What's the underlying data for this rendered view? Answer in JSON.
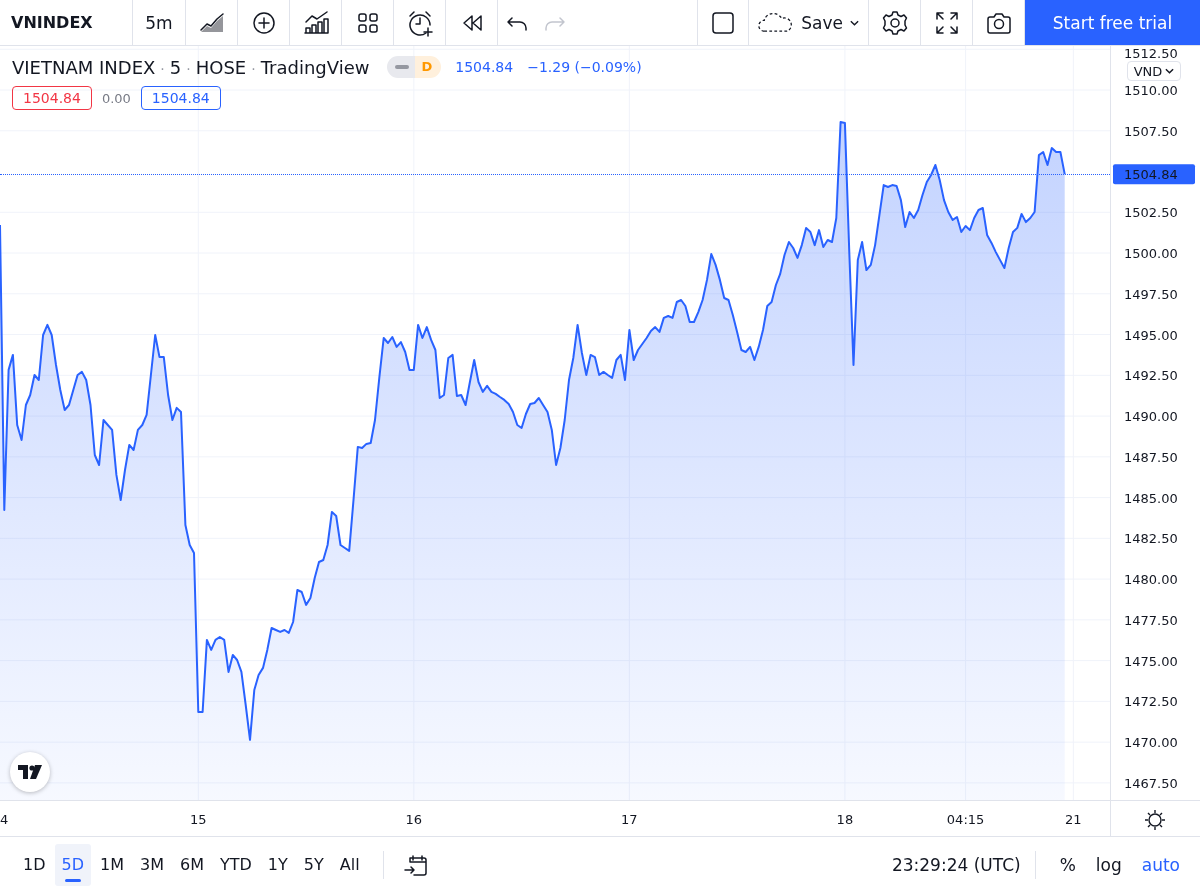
{
  "toolbar": {
    "symbol": "VNINDEX",
    "interval": "5m",
    "tools": [
      {
        "kind": "area-style",
        "disabled": false
      },
      {
        "kind": "add",
        "disabled": false
      },
      {
        "kind": "indicators",
        "disabled": false
      },
      {
        "kind": "layout",
        "disabled": false
      },
      {
        "kind": "alert",
        "disabled": false
      },
      {
        "kind": "replay",
        "disabled": false
      },
      {
        "kind": "undo",
        "disabled": false
      },
      {
        "kind": "redo",
        "disabled": true
      }
    ],
    "right_tools": [
      {
        "kind": "rectangle"
      }
    ],
    "save": {
      "label": "Save"
    },
    "extra_tools": [
      {
        "kind": "settings"
      },
      {
        "kind": "fullscreen"
      },
      {
        "kind": "snapshot"
      }
    ],
    "trial_button": "Start free trial"
  },
  "legend": {
    "title_parts": [
      "VIETNAM INDEX",
      "5",
      "HOSE",
      "TradingView"
    ],
    "separator": "·",
    "badge": "D",
    "price": "1504.84",
    "change": "−1.29 (−0.09%)",
    "values": [
      {
        "kind": "boxed",
        "text": "1504.84",
        "color": "#f23645"
      },
      {
        "kind": "plain",
        "text": "0.00",
        "color": "#787b86"
      },
      {
        "kind": "boxed",
        "text": "1504.84",
        "color": "#2962ff"
      }
    ]
  },
  "currency": "VND",
  "chart": {
    "last_price_label": "1504.84",
    "time_axis": [
      "4",
      "15",
      "16",
      "17",
      "18",
      "04:15",
      "21"
    ],
    "chart_data": {
      "type": "area",
      "ylim": [
        1466.45,
        1512.7
      ],
      "grid": true,
      "yticks": [
        {
          "value": 1467.5,
          "label": "1467.50"
        },
        {
          "value": 1470,
          "label": "1470.00"
        },
        {
          "value": 1472.5,
          "label": "1472.50"
        },
        {
          "value": 1475,
          "label": "1475.00"
        },
        {
          "value": 1477.5,
          "label": "1477.50"
        },
        {
          "value": 1480,
          "label": "1480.00"
        },
        {
          "value": 1482.5,
          "label": "1482.50"
        },
        {
          "value": 1485,
          "label": "1485.00"
        },
        {
          "value": 1487.5,
          "label": "1487.50"
        },
        {
          "value": 1490,
          "label": "1490.00"
        },
        {
          "value": 1492.5,
          "label": "1492.50"
        },
        {
          "value": 1495,
          "label": "1495.00"
        },
        {
          "value": 1497.5,
          "label": "1497.50"
        },
        {
          "value": 1500,
          "label": "1500.00"
        },
        {
          "value": 1502.5,
          "label": "1502.50"
        },
        {
          "value": 1507.5,
          "label": "1507.50"
        },
        {
          "value": 1510,
          "label": "1510.00"
        },
        {
          "value": 1512.5,
          "label": "1512.50"
        }
      ],
      "series": [
        {
          "color": "#2962ff",
          "values": [
            1501.72,
            1484.24,
            1492.83,
            1493.75,
            1489.45,
            1488.53,
            1490.68,
            1491.29,
            1492.52,
            1492.21,
            1494.97,
            1495.59,
            1494.97,
            1493.13,
            1491.6,
            1490.37,
            1490.68,
            1491.6,
            1492.52,
            1492.71,
            1492.21,
            1490.68,
            1487.61,
            1487.0,
            1489.76,
            1489.45,
            1489.15,
            1486.39,
            1484.85,
            1486.69,
            1488.23,
            1487.92,
            1489.15,
            1489.45,
            1490.07,
            1492.52,
            1494.97,
            1493.62,
            1493.62,
            1491.29,
            1489.76,
            1490.5,
            1490.25,
            1483.32,
            1482.09,
            1481.6,
            1471.85,
            1471.85,
            1476.27,
            1475.66,
            1476.27,
            1476.45,
            1476.27,
            1474.31,
            1475.35,
            1475.04,
            1474.31,
            1472.28,
            1470.14,
            1473.2,
            1474.12,
            1474.55,
            1475.66,
            1477.0,
            1476.88,
            1476.76,
            1476.88,
            1476.7,
            1477.37,
            1479.33,
            1479.21,
            1478.42,
            1478.84,
            1480.07,
            1481.05,
            1481.17,
            1482.09,
            1484.12,
            1483.87,
            1482.09,
            1481.91,
            1481.73,
            1484.85,
            1488.11,
            1488.04,
            1488.29,
            1488.35,
            1489.76,
            1492.34,
            1494.79,
            1494.48,
            1494.85,
            1494.24,
            1494.54,
            1493.93,
            1492.83,
            1492.83,
            1495.59,
            1494.79,
            1495.46,
            1494.67,
            1494.05,
            1491.11,
            1491.29,
            1493.56,
            1493.75,
            1491.23,
            1491.29,
            1490.68,
            1492.09,
            1493.44,
            1492.09,
            1491.48,
            1491.85,
            1491.48,
            1491.36,
            1491.17,
            1490.99,
            1490.74,
            1490.25,
            1489.45,
            1489.27,
            1490.13,
            1490.74,
            1490.8,
            1491.11,
            1490.68,
            1490.25,
            1489.15,
            1487.0,
            1488.04,
            1489.76,
            1492.21,
            1493.56,
            1495.59,
            1493.87,
            1492.52,
            1493.75,
            1493.62,
            1492.52,
            1492.71,
            1492.52,
            1492.34,
            1493.44,
            1493.75,
            1492.21,
            1495.28,
            1493.44,
            1494.05,
            1494.42,
            1494.79,
            1495.22,
            1495.46,
            1495.16,
            1496.02,
            1496.14,
            1496.02,
            1497.0,
            1497.12,
            1496.75,
            1495.77,
            1495.77,
            1496.38,
            1497.12,
            1498.35,
            1499.94,
            1499.27,
            1498.35,
            1497.24,
            1497.12,
            1496.2,
            1495.16,
            1494.05,
            1493.93,
            1494.24,
            1493.44,
            1494.24,
            1495.28,
            1496.75,
            1497.0,
            1498.04,
            1498.72,
            1499.88,
            1500.68,
            1500.31,
            1499.7,
            1500.49,
            1501.54,
            1501.29,
            1500.49,
            1501.41,
            1500.37,
            1500.8,
            1500.68,
            1502.15,
            1508.04,
            1507.98,
            1500.19,
            1493.13,
            1499.57,
            1500.68,
            1498.96,
            1499.27,
            1500.49,
            1502.33,
            1504.17,
            1504.05,
            1504.17,
            1504.11,
            1503.25,
            1501.6,
            1502.52,
            1502.15,
            1502.64,
            1503.56,
            1504.36,
            1504.79,
            1505.4,
            1504.48,
            1503.25,
            1502.52,
            1502.03,
            1502.21,
            1501.29,
            1501.66,
            1501.41,
            1502.15,
            1502.64,
            1502.76,
            1501.11,
            1500.62,
            1500.06,
            1499.57,
            1499.08,
            1500.31,
            1501.29,
            1501.54,
            1502.4,
            1501.9,
            1502.15,
            1502.52,
            1506.01,
            1506.2,
            1505.4,
            1506.44,
            1506.2,
            1506.2,
            1504.84
          ]
        }
      ]
    }
  },
  "bottom_bar": {
    "ranges": [
      {
        "label": "1D",
        "selected": false
      },
      {
        "label": "5D",
        "selected": true
      },
      {
        "label": "1M",
        "selected": false
      },
      {
        "label": "3M",
        "selected": false
      },
      {
        "label": "6M",
        "selected": false
      },
      {
        "label": "YTD",
        "selected": false
      },
      {
        "label": "1Y",
        "selected": false
      },
      {
        "label": "5Y",
        "selected": false
      },
      {
        "label": "All",
        "selected": false
      }
    ],
    "time": "23:29:24 (UTC)",
    "scale_options": [
      {
        "label": "%",
        "on": false
      },
      {
        "label": "log",
        "on": false
      },
      {
        "label": "auto",
        "on": true
      }
    ]
  }
}
